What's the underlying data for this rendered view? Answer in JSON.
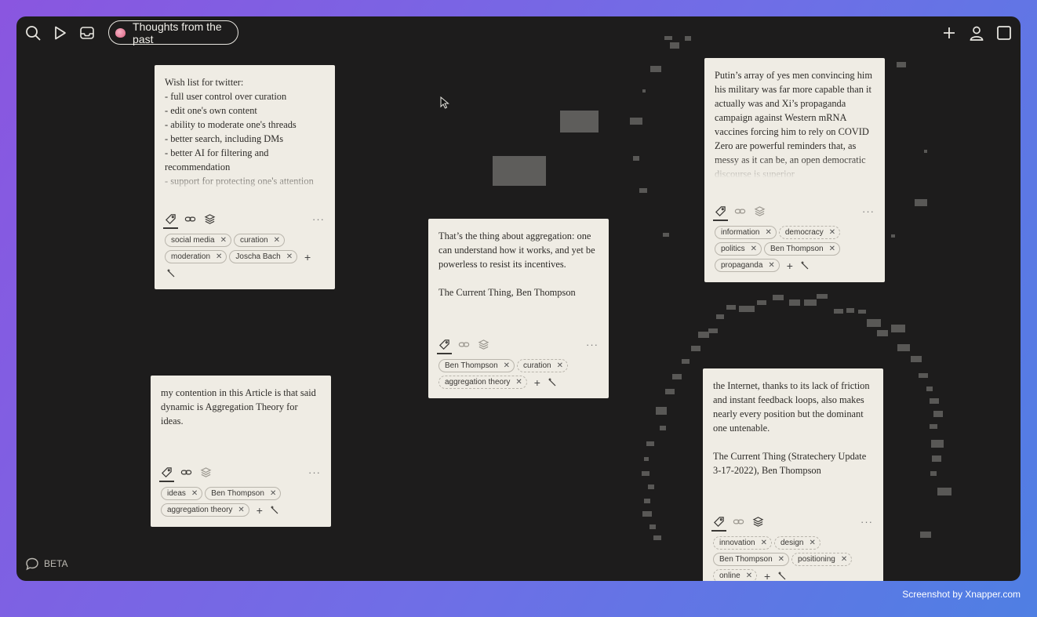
{
  "topbar": {
    "view_title": "Thoughts from the past",
    "icons": [
      "search-icon",
      "play-icon",
      "inbox-icon",
      "plus-icon",
      "user-icon",
      "window-icon"
    ]
  },
  "cards": [
    {
      "text": "Wish list for twitter:\n- full user control over curation\n- edit one's own content\n- ability to moderate one's threads\n- better search, including DMs\n- better AI for filtering and recommendation\n- support for protecting one's attention",
      "tags": [
        "social media",
        "curation",
        "moderation",
        "Joscha Bach"
      ]
    },
    {
      "text": "That’s the thing about aggregation: one can understand how it works, and yet be powerless to resist its incentives.\n\nThe Current Thing, Ben Thompson",
      "tags": [
        "Ben Thompson",
        "curation",
        "aggregation theory"
      ]
    },
    {
      "text": "Putin’s array of yes men convincing him his military was far more capable than it actually was and Xi’s propaganda campaign against Western mRNA vaccines forcing him to rely on COVID Zero are powerful reminders that, as messy as it can be, an open democratic discourse is superior",
      "tags": [
        "information",
        "democracy",
        "politics",
        "Ben Thompson",
        "propaganda"
      ]
    },
    {
      "text": "my contention in this Article is that said dynamic is Aggregation Theory for ideas.",
      "tags": [
        "ideas",
        "Ben Thompson",
        "aggregation theory"
      ]
    },
    {
      "text": "the Internet, thanks to its lack of friction and instant feedback loops, also makes nearly every position but the dominant one untenable.\n\nThe Current Thing (Stratechery Update 3-17-2022), Ben Thompson",
      "tags": [
        "innovation",
        "design",
        "Ben Thompson",
        "positioning",
        "online"
      ]
    }
  ],
  "footer": {
    "beta_label": "BETA"
  },
  "watermark": "Screenshot by Xnapper.com",
  "colors": {
    "canvas_bg": "#1d1c1c",
    "card_bg": "#efece4",
    "block_gray": "#595856"
  }
}
